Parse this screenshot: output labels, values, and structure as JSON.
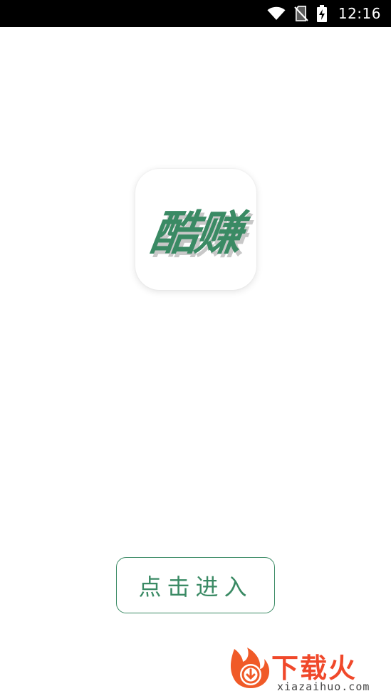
{
  "status_bar": {
    "time": "12:16",
    "icons": [
      "wifi-icon",
      "no-sim-icon",
      "battery-charging-icon"
    ]
  },
  "app": {
    "icon_text": "酷赚",
    "accent_color": "#3a8a64"
  },
  "enter_button": {
    "label": "点击进入"
  },
  "watermark": {
    "title": "下载火",
    "subtitle": "xiazaihuo.com",
    "color": "#f0482a"
  }
}
